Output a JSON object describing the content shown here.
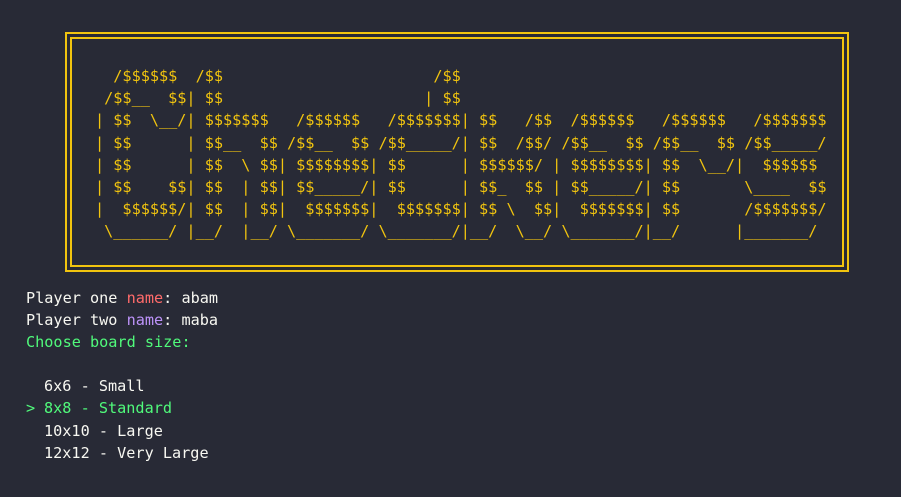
{
  "banner": {
    "ascii": [
      "  /$$$$$$  /$$                       /$$",
      " /$$__  $$| $$                      | $$",
      "| $$  \\__/| $$$$$$$   /$$$$$$   /$$$$$$$| $$   /$$  /$$$$$$   /$$$$$$   /$$$$$$$",
      "| $$      | $$__  $$ /$$__  $$ /$$_____/| $$  /$$/ /$$__  $$ /$$__  $$ /$$_____/",
      "| $$      | $$  \\ $$| $$$$$$$$| $$      | $$$$$$/ | $$$$$$$$| $$  \\__/|  $$$$$$",
      "| $$    $$| $$  | $$| $$_____/| $$      | $$_  $$ | $$_____/| $$       \\____  $$",
      "|  $$$$$$/| $$  | $$|  $$$$$$$|  $$$$$$$| $$ \\  $$|  $$$$$$$| $$       /$$$$$$$/",
      " \\______/ |__/  |__/ \\_______/ \\_______/|__/  \\__/ \\_______/|__/      |_______/"
    ]
  },
  "prompts": {
    "player_one": {
      "prefix": "Player one ",
      "keyword": "name",
      "suffix": ": abam"
    },
    "player_two": {
      "prefix": "Player two ",
      "keyword": "name",
      "suffix": ": maba"
    },
    "board_size": "Choose board size:"
  },
  "menu": {
    "pointer": ">",
    "items": [
      {
        "label": "6x6 - Small",
        "selected": false
      },
      {
        "label": "8x8 - Standard",
        "selected": true
      },
      {
        "label": "10x10 - Large",
        "selected": false
      },
      {
        "label": "12x12 - Very Large",
        "selected": false
      }
    ]
  },
  "colors": {
    "background": "#282a36",
    "foreground": "#f8f8f2",
    "banner": "#f1c40f",
    "name_keyword_1": "#ff6b6b",
    "name_keyword_2": "#bd93f9",
    "prompt": "#50fa7b",
    "selected": "#50fa7b"
  }
}
